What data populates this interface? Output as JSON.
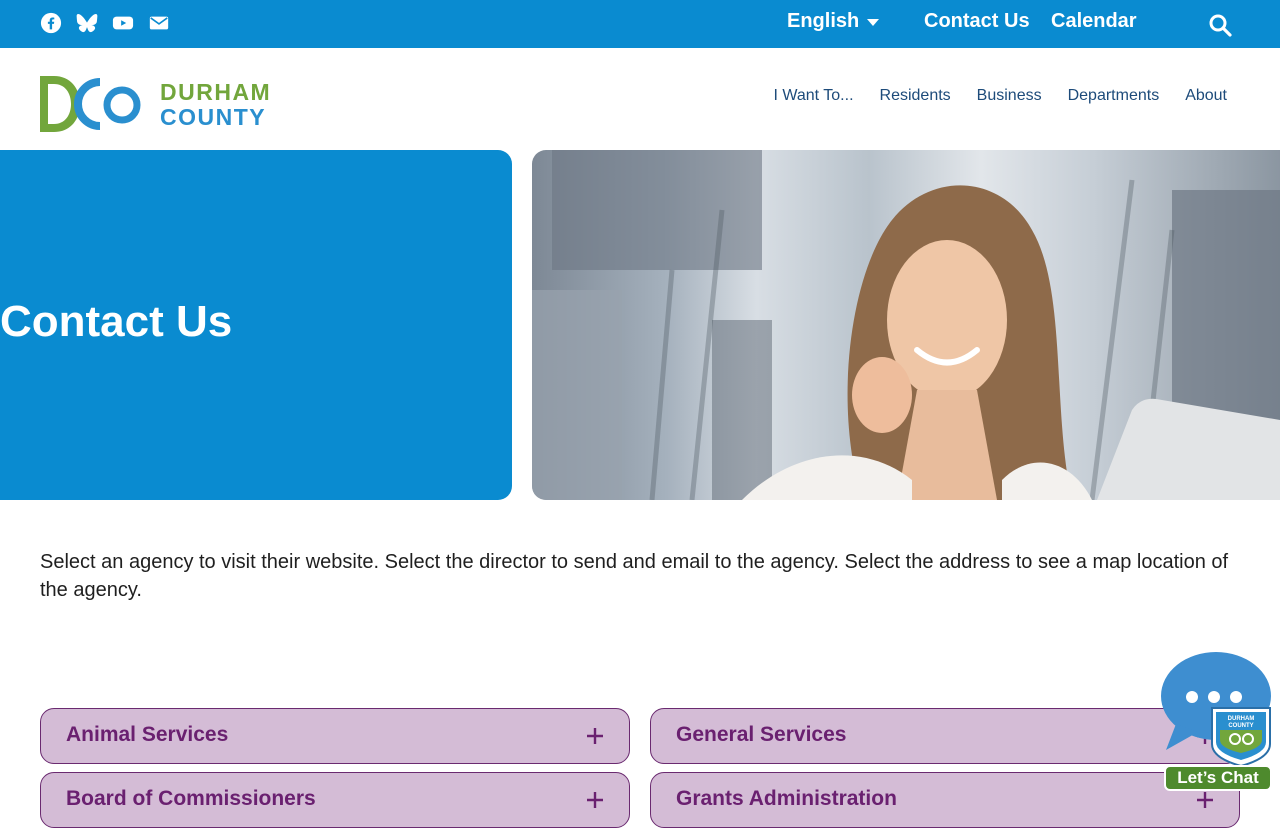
{
  "topbar": {
    "social_icons": [
      "facebook-icon",
      "bluesky-icon",
      "youtube-icon",
      "email-icon"
    ],
    "language": "English",
    "links": [
      "Contact Us",
      "Calendar"
    ],
    "search_icon": "search-icon"
  },
  "header": {
    "logo": {
      "mark": "DCO",
      "line1": "DURHAM",
      "line2": "COUNTY"
    },
    "nav": [
      "I Want To...",
      "Residents",
      "Business",
      "Departments",
      "About"
    ]
  },
  "hero": {
    "title": "Contact Us"
  },
  "intro": "Select an agency to visit their website. Select the director to send and email to the agency. Select the address to see a map location of the agency.",
  "accordion": [
    "Animal Services",
    "General Services",
    "Board of Commissioners",
    "Grants Administration"
  ],
  "chat": {
    "label": "Let’s Chat",
    "badge_line1": "DURHAM",
    "badge_line2": "COUNTY"
  },
  "colors": {
    "brand_blue": "#0a8bd0",
    "brand_green": "#72a63c",
    "accordion_bg": "#d4bcd6",
    "accordion_text": "#6a2070"
  }
}
